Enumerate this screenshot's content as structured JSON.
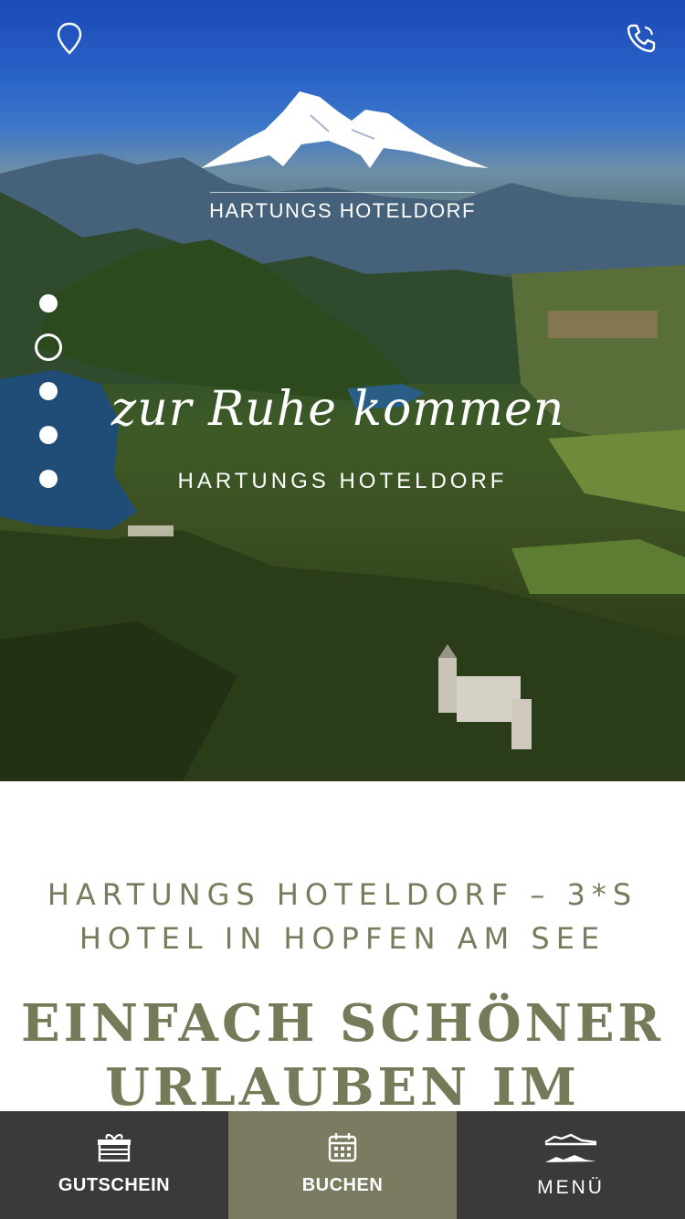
{
  "header": {
    "location_icon": "map-pin-icon",
    "phone_icon": "phone-icon"
  },
  "logo": {
    "text": "HARTUNGS HOTELDORF"
  },
  "hero": {
    "tagline": "zur Ruhe kommen",
    "subtitle": "HARTUNGS HOTELDORF",
    "slides_total": 5,
    "active_slide": 2
  },
  "intro": {
    "line1": "HARTUNGS HOTELDORF – 3*S",
    "line2": "HOTEL IN HOPFEN AM SEE"
  },
  "headline": {
    "line1": "EINFACH SCHÖNER",
    "line2": "URLAUBEN IM"
  },
  "bottom_nav": {
    "voucher_label": "GUTSCHEIN",
    "voucher_icon": "gift-icon",
    "book_label": "BUCHEN",
    "book_icon": "calendar-icon",
    "menu_label": "MENÜ",
    "menu_icon": "mountain-menu-icon"
  },
  "colors": {
    "accent_olive": "#7b7b61",
    "dark_bar": "#3a3a3a",
    "text_olive": "#7a7b5c"
  }
}
